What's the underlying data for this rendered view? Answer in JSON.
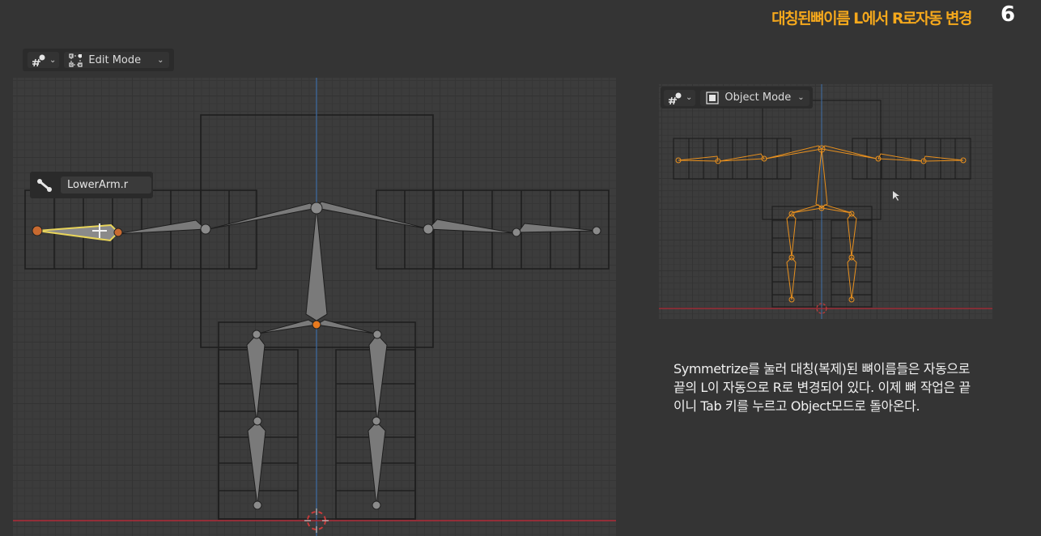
{
  "slide": {
    "title": "대칭된뼈이름 L에서 R로자동 변경",
    "page_number": "6",
    "description": "Symmetrize를 눌러 대칭(복제)된 뼈이름들은 자동으로 끝의 L이 자동으로 R로 변경되어 있다.  이제 뼈 작업은 끝이니 Tab 키를 누르고 Object모드로 돌아온다."
  },
  "main_viewport": {
    "mode_label": "Edit Mode",
    "active_bone_label": "LowerArm.r"
  },
  "side_viewport": {
    "mode_label": "Object Mode"
  },
  "colors": {
    "title": "#f5a81c",
    "selected_bone": "#e8d45a",
    "armature_object": "#e8901e",
    "x_axis": "#b02a36",
    "y_axis": "#3f6fa8",
    "bone_fill": "#7a7a7a"
  },
  "icons": [
    "armature-icon",
    "edit-mode-icon",
    "object-mode-icon",
    "bone-icon",
    "3d-cursor-icon",
    "move-cursor-icon",
    "chevron-down-icon"
  ]
}
